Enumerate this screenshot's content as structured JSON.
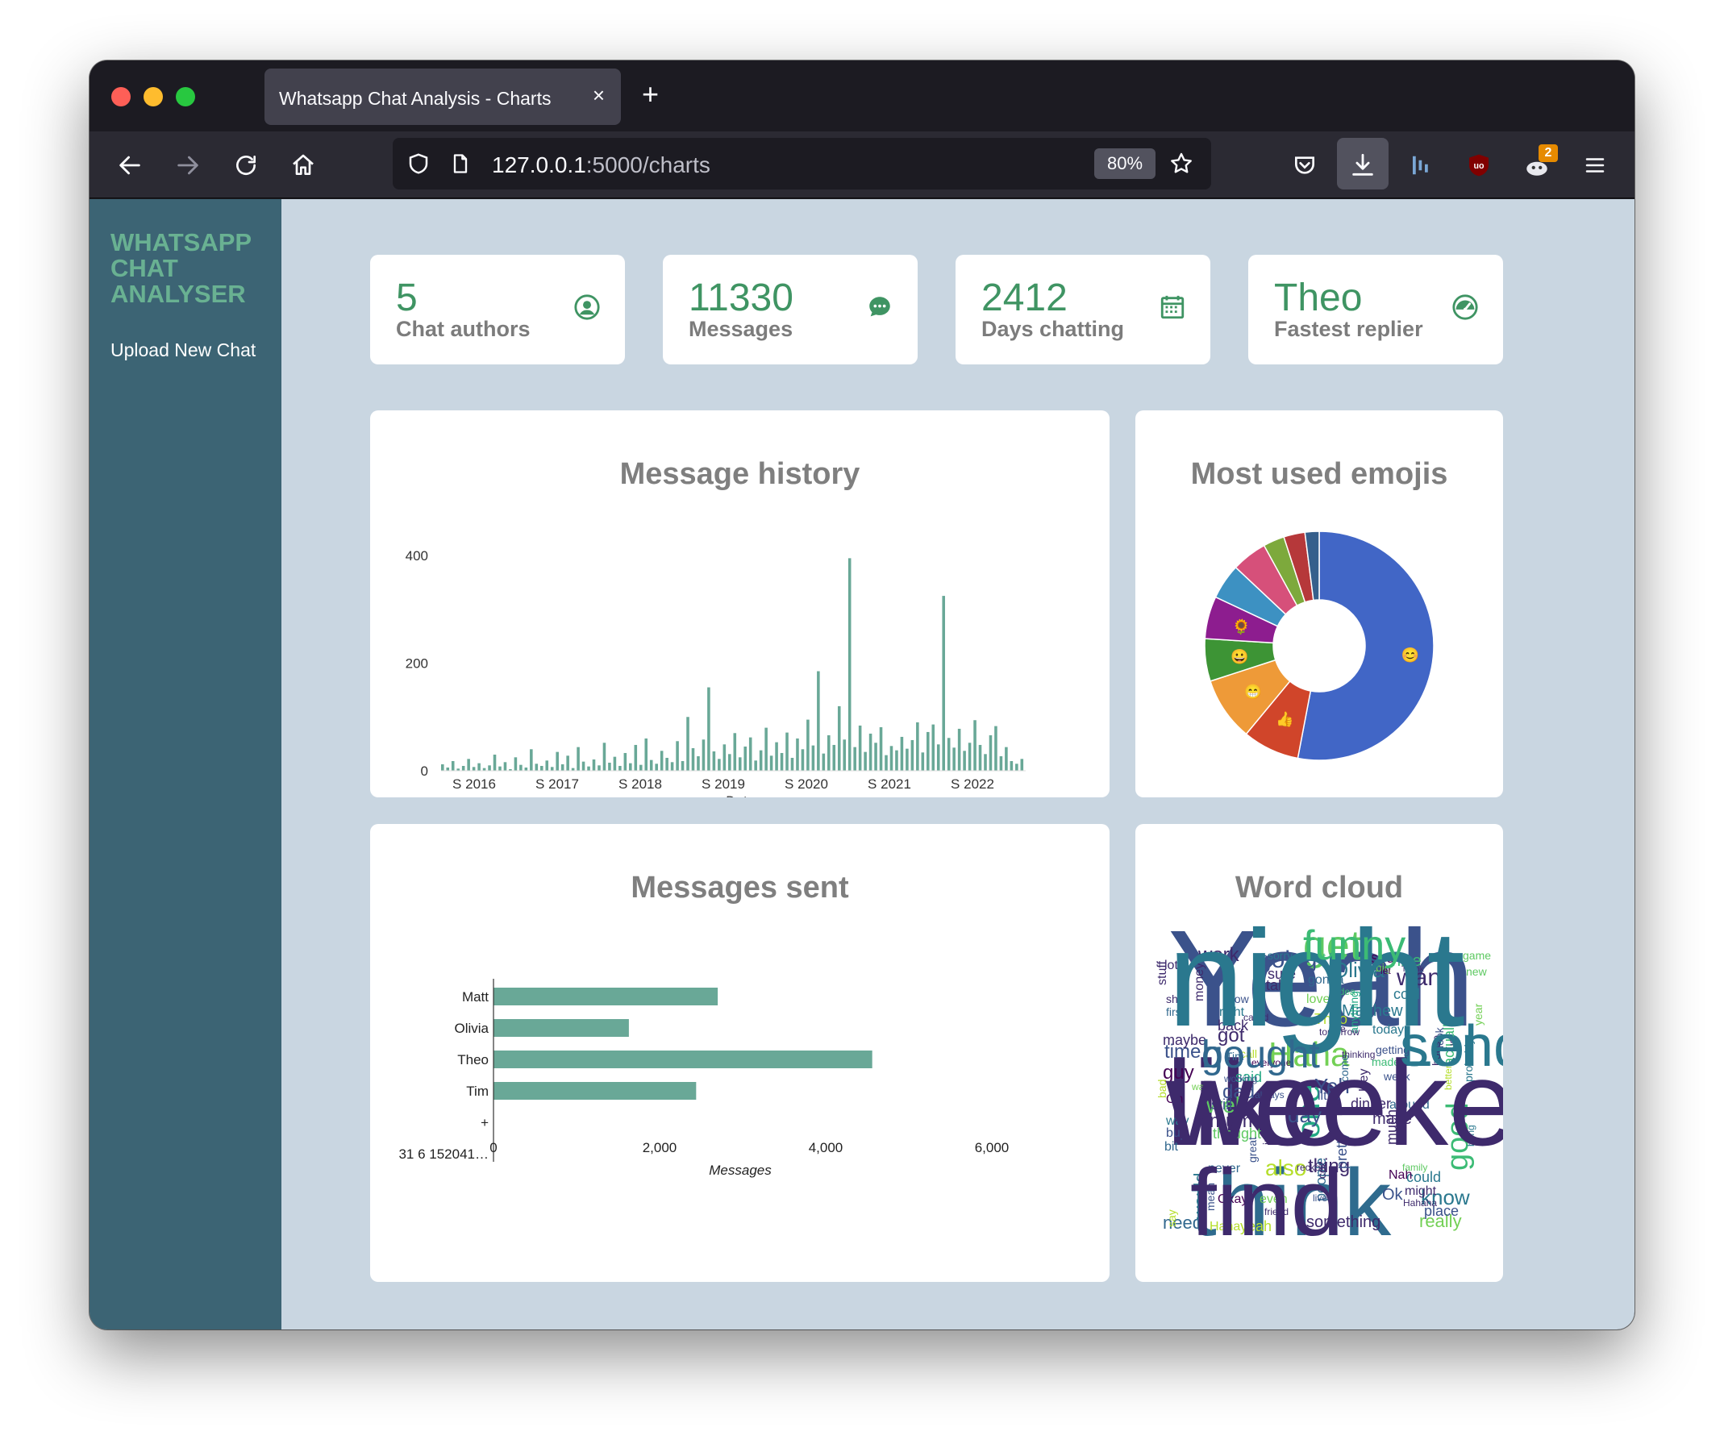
{
  "browser": {
    "tab_title": "Whatsapp Chat Analysis - Charts",
    "tab_close": "×",
    "new_tab": "+",
    "url_host": "127.0.0.1",
    "url_path": ":5000/charts",
    "zoom": "80%",
    "extension_badge": "2",
    "icons": [
      "back-icon",
      "forward-icon",
      "reload-icon",
      "home-icon",
      "shield-icon",
      "page-icon",
      "star-icon",
      "pocket-icon",
      "download-icon",
      "extension-icon",
      "ublock-icon",
      "profile-icon",
      "menu-icon"
    ]
  },
  "sidebar": {
    "brand_line1": "WHATSAPP",
    "brand_line2": "CHAT",
    "brand_line3": "ANALYSER",
    "upload_link": "Upload New Chat"
  },
  "stats": [
    {
      "value": "5",
      "label": "Chat authors",
      "icon": "user-circle-icon"
    },
    {
      "value": "11330",
      "label": "Messages",
      "icon": "chat-bubble-icon"
    },
    {
      "value": "2412",
      "label": "Days chatting",
      "icon": "calendar-icon"
    },
    {
      "value": "Theo",
      "label": "Fastest replier",
      "icon": "speedometer-icon"
    }
  ],
  "colors": {
    "accent": "#3f9463",
    "bar": "#69a897",
    "sidebar": "#3c6474",
    "background": "#c9d6e1",
    "brand": "#69b192"
  },
  "panels": {
    "history_title": "Message history",
    "emojis_title": "Most used emojis",
    "sent_title": "Messages sent",
    "wordcloud_title": "Word cloud"
  },
  "chart_data": [
    {
      "type": "bar",
      "title": "Message history",
      "xlabel": "Date",
      "ylabel": "",
      "ylim": [
        0,
        430
      ],
      "x_ticks": [
        "S 2016",
        "S 2017",
        "S 2018",
        "S 2019",
        "S 2020",
        "S 2021",
        "S 2022"
      ],
      "y_ticks": [
        "0",
        "200",
        "400"
      ],
      "peaks": [
        {
          "date": "2020-03",
          "value": 395
        },
        {
          "date": "2021-04",
          "value": 325
        },
        {
          "date": "2019-12",
          "value": 185
        },
        {
          "date": "2018-05",
          "value": 155
        }
      ],
      "values": [
        12,
        6,
        18,
        4,
        9,
        22,
        7,
        14,
        5,
        10,
        30,
        8,
        16,
        3,
        25,
        11,
        6,
        40,
        13,
        9,
        19,
        7,
        35,
        12,
        28,
        5,
        44,
        17,
        8,
        21,
        10,
        52,
        15,
        26,
        9,
        33,
        14,
        48,
        11,
        60,
        20,
        13,
        37,
        24,
        16,
        55,
        18,
        100,
        42,
        27,
        58,
        155,
        36,
        22,
        49,
        31,
        70,
        25,
        45,
        62,
        19,
        38,
        80,
        28,
        53,
        33,
        71,
        24,
        60,
        40,
        95,
        47,
        185,
        32,
        66,
        48,
        120,
        58,
        395,
        44,
        84,
        35,
        69,
        52,
        81,
        29,
        46,
        38,
        63,
        41,
        57,
        90,
        34,
        72,
        86,
        49,
        325,
        61,
        43,
        78,
        37,
        52,
        94,
        48,
        31,
        66,
        83,
        27,
        44,
        18,
        13,
        22
      ]
    },
    {
      "type": "pie",
      "title": "Most used emojis",
      "slices": [
        {
          "label": "😊",
          "value": 53,
          "color": "#4166c6"
        },
        {
          "label": "👍",
          "value": 8,
          "color": "#d0452a"
        },
        {
          "label": "😁",
          "value": 9,
          "color": "#ee9a38"
        },
        {
          "label": "😀",
          "value": 6,
          "color": "#3d9435"
        },
        {
          "label": "🌻",
          "value": 6,
          "color": "#8d1d8f"
        },
        {
          "label": "",
          "value": 5,
          "color": "#3d91c2"
        },
        {
          "label": "",
          "value": 5,
          "color": "#d6507a"
        },
        {
          "label": "",
          "value": 3,
          "color": "#7da93c"
        },
        {
          "label": "",
          "value": 3,
          "color": "#b6383a"
        },
        {
          "label": "",
          "value": 2,
          "color": "#355f8c"
        }
      ]
    },
    {
      "type": "bar",
      "orientation": "horizontal",
      "title": "Messages sent",
      "xlabel": "Messages",
      "xlim": [
        0,
        6200
      ],
      "x_ticks": [
        "0",
        "2,000",
        "4,000",
        "6,000"
      ],
      "categories": [
        "Matt",
        "Olivia",
        "Theo",
        "Tim",
        "+",
        "31 6 152041…"
      ],
      "values": [
        2700,
        1630,
        4560,
        2440,
        0,
        0
      ]
    }
  ],
  "wordcloud": {
    "words": [
      {
        "t": "Yeah",
        "c": "#3b528b"
      },
      {
        "t": "like",
        "c": "#3e2a6c"
      },
      {
        "t": "think",
        "c": "#2f6b8e"
      },
      {
        "t": "Lol",
        "c": "#2a788e"
      },
      {
        "t": "get",
        "c": "#5ec962"
      },
      {
        "t": "go",
        "c": "#31688e"
      },
      {
        "t": "Haha",
        "c": "#73d055"
      },
      {
        "t": "good",
        "c": "#3cbb75"
      },
      {
        "t": "one",
        "c": "#22a884"
      },
      {
        "t": "want",
        "c": "#3e2a6c"
      },
      {
        "t": "Olivia",
        "c": "#2a788e"
      },
      {
        "t": "going",
        "c": "#3b528b"
      },
      {
        "t": "work",
        "c": "#3e2a6c"
      },
      {
        "t": "time",
        "c": "#3b528b"
      },
      {
        "t": "guy",
        "c": "#440154"
      },
      {
        "t": "got",
        "c": "#3e2a6c"
      },
      {
        "t": "dad",
        "c": "#3b528b"
      },
      {
        "t": "well",
        "c": "#5ec962"
      },
      {
        "t": "mum",
        "c": "#3e2a6c"
      },
      {
        "t": "day",
        "c": "#3b528b"
      },
      {
        "t": "know",
        "c": "#2a788e"
      },
      {
        "t": "really",
        "c": "#73d055"
      },
      {
        "t": "need",
        "c": "#31688e"
      },
      {
        "t": "something",
        "c": "#3e2a6c"
      },
      {
        "t": "also",
        "c": "#b5de2b"
      },
      {
        "t": "thing",
        "c": "#3e2a6c"
      },
      {
        "t": "Yeh",
        "c": "#3b528b"
      },
      {
        "t": "make",
        "c": "#3e2a6c"
      },
      {
        "t": "maybe",
        "c": "#3e2a6c"
      },
      {
        "t": "Matthew",
        "c": "#2a788e"
      },
      {
        "t": "nice",
        "c": "#3cbb75"
      },
      {
        "t": "cool",
        "c": "#2a788e"
      },
      {
        "t": "sure",
        "c": "#3e2a6c"
      },
      {
        "t": "gonna",
        "c": "#31688e"
      },
      {
        "t": "see",
        "c": "#440154"
      },
      {
        "t": "back",
        "c": "#3e2a6c"
      },
      {
        "t": "right",
        "c": "#2a788e"
      },
      {
        "t": "place",
        "c": "#3b528b"
      },
      {
        "t": "Okay",
        "c": "#440154"
      },
      {
        "t": "could",
        "c": "#2a788e"
      },
      {
        "t": "might",
        "c": "#3e2a6c"
      },
      {
        "t": "thought",
        "c": "#5ec962"
      },
      {
        "t": "Theo",
        "c": "#b5de2b"
      },
      {
        "t": "dinner",
        "c": "#3e2a6c"
      },
      {
        "t": "around",
        "c": "#31688e"
      },
      {
        "t": "still",
        "c": "#3b528b"
      },
      {
        "t": "yeah",
        "c": "#b5de2b"
      },
      {
        "t": "never",
        "c": "#31688e"
      },
      {
        "t": "probably",
        "c": "#2a788e"
      },
      {
        "t": "actually",
        "c": "#3cbb75"
      },
      {
        "t": "take",
        "c": "#3e2a6c"
      },
      {
        "t": "love",
        "c": "#73d055"
      },
      {
        "t": "pretty",
        "c": "#3b528b"
      },
      {
        "t": "people",
        "c": "#31688e"
      },
      {
        "t": "would",
        "c": "#2a788e"
      },
      {
        "t": "Haha",
        "c": "#b5de2b"
      },
      {
        "t": "Nah",
        "c": "#440154"
      },
      {
        "t": "Ok",
        "c": "#3b528b"
      },
      {
        "t": "lot",
        "c": "#3e2a6c"
      },
      {
        "t": "sorry",
        "c": "#2a788e"
      },
      {
        "t": "meet",
        "c": "#3cbb75"
      },
      {
        "t": "game",
        "c": "#5ec962"
      },
      {
        "t": "stuff",
        "c": "#3e2a6c"
      },
      {
        "t": "said",
        "c": "#22a884"
      },
      {
        "t": "much",
        "c": "#3e2a6c"
      },
      {
        "t": "even",
        "c": "#73d055"
      },
      {
        "t": "way",
        "c": "#2a788e"
      },
      {
        "t": "buy",
        "c": "#3b528b"
      },
      {
        "t": "bit",
        "c": "#31688e"
      },
      {
        "t": "Oh",
        "c": "#440154"
      },
      {
        "t": "us",
        "c": "#3e2a6c"
      },
      {
        "t": "idea",
        "c": "#3cbb75"
      },
      {
        "t": "first",
        "c": "#31688e"
      },
      {
        "t": "show",
        "c": "#3b528b"
      },
      {
        "t": "week",
        "c": "#3b528b"
      },
      {
        "t": "come",
        "c": "#31688e"
      },
      {
        "t": "Hey",
        "c": "#3e2a6c"
      },
      {
        "t": "look",
        "c": "#3b528b"
      },
      {
        "t": "year",
        "c": "#73d055"
      },
      {
        "t": "today",
        "c": "#2a788e"
      },
      {
        "t": "getting",
        "c": "#3b528b"
      },
      {
        "t": "made",
        "c": "#3cbb75"
      },
      {
        "t": "new",
        "c": "#5ec962"
      },
      {
        "t": "big",
        "c": "#73d055"
      },
      {
        "t": "shit",
        "c": "#3e2a6c"
      },
      {
        "t": "call",
        "c": "#b5de2b"
      },
      {
        "t": "money",
        "c": "#3e2a6c"
      },
      {
        "t": "Tim",
        "c": "#31688e"
      },
      {
        "t": "mean",
        "c": "#3b528b"
      },
      {
        "t": "friend",
        "c": "#3e2a6c"
      },
      {
        "t": "say",
        "c": "#b5de2b"
      },
      {
        "t": "bad",
        "c": "#b5de2b"
      },
      {
        "t": "great",
        "c": "#3b528b"
      },
      {
        "t": "coz",
        "c": "#3e2a6c"
      },
      {
        "t": "reckon",
        "c": "#3e2a6c"
      },
      {
        "t": "little",
        "c": "#3b528b"
      },
      {
        "t": "let",
        "c": "#440154"
      },
      {
        "t": "house",
        "c": "#3e2a6c"
      },
      {
        "t": "ye",
        "c": "#3e2a6c"
      },
      {
        "t": "im",
        "c": "#3e2a6c"
      },
      {
        "t": "family",
        "c": "#5ec962"
      },
      {
        "t": "live",
        "c": "#3b528b"
      },
      {
        "t": "Hahaha",
        "c": "#3e2a6c"
      },
      {
        "t": "thinking",
        "c": "#3e2a6c"
      },
      {
        "t": "anything",
        "c": "#22a884"
      },
      {
        "t": "always",
        "c": "#3b528b"
      },
      {
        "t": "bring",
        "c": "#2a788e"
      },
      {
        "t": "Thank",
        "c": "#3e2a6c"
      },
      {
        "t": "better",
        "c": "#b5de2b"
      },
      {
        "t": "watch",
        "c": "#73d055"
      },
      {
        "t": "tomorrow",
        "c": "#3e2a6c"
      },
      {
        "t": "everyone",
        "c": "#440154"
      },
      {
        "t": "working",
        "c": "#3b528b"
      },
      {
        "t": "called",
        "c": "#3e2a6c"
      },
      {
        "t": "night",
        "c": "#2a788e"
      },
      {
        "t": "weekend",
        "c": "#3e2a6c"
      },
      {
        "t": "find",
        "c": "#3e2a6c"
      },
      {
        "t": "send",
        "c": "#2a788e"
      },
      {
        "t": "funny",
        "c": "#3cbb75"
      },
      {
        "t": "bought",
        "c": "#31688e"
      }
    ]
  }
}
